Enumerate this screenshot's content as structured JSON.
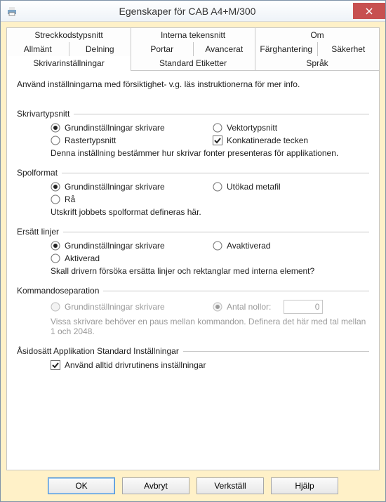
{
  "window": {
    "title": "Egenskaper för CAB A4+M/300"
  },
  "tabs": {
    "row1": [
      "Streckkodstypsnitt",
      "Interna tekensnitt",
      "Om"
    ],
    "row2": [
      "Allmänt",
      "Delning",
      "Portar",
      "Avancerat",
      "Färghantering",
      "Säkerhet"
    ],
    "row3": [
      "Skrivarinställningar",
      "Standard Etiketter",
      "Språk"
    ]
  },
  "intro": "Använd inställningarna med försiktighet- v.g. läs instruktionerna för mer info.",
  "printerFonts": {
    "legend": "Skrivartypsnitt",
    "opt_default": "Grundinställningar skrivare",
    "opt_vector": "Vektortypsnitt",
    "opt_raster": "Rastertypsnitt",
    "opt_concat": "Konkatinerade tecken",
    "note": "Denna inställning bestämmer hur skrivar fonter presenteras för applikationen."
  },
  "spool": {
    "legend": "Spolformat",
    "opt_default": "Grundinställningar skrivare",
    "opt_ext": "Utökad metafil",
    "opt_raw": "Rå",
    "note": "Utskrift jobbets spolformat defineras här."
  },
  "replace": {
    "legend": "Ersätt linjer",
    "opt_default": "Grundinställningar skrivare",
    "opt_disabled": "Avaktiverad",
    "opt_enabled": "Aktiverad",
    "note": "Skall drivern försöka ersätta linjer och rektanglar med interna element?"
  },
  "cmdsep": {
    "legend": "Kommandoseparation",
    "opt_default": "Grundinställningar skrivare",
    "opt_zeros": "Antal nollor:",
    "value": "0",
    "note": "Vissa skrivare behöver en paus mellan kommandon. Definera det här med tal mellan 1 och 2048."
  },
  "override": {
    "legend": "Åsidosätt Applikation Standard Inställningar",
    "opt_always": "Använd alltid drivrutinens inställningar"
  },
  "buttons": {
    "ok": "OK",
    "cancel": "Avbryt",
    "apply": "Verkställ",
    "help": "Hjälp"
  }
}
